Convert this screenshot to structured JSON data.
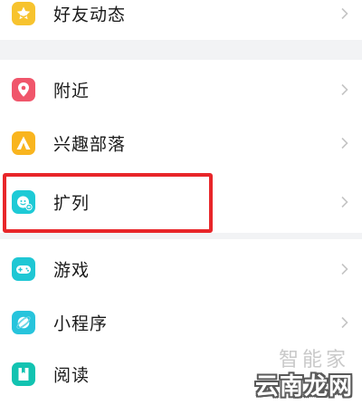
{
  "menu": {
    "items": [
      {
        "label": "好友动态",
        "icon": "star-icon",
        "color": "#f7c32e"
      },
      {
        "label": "附近",
        "icon": "location-pin-icon",
        "color": "#f0566b"
      },
      {
        "label": "兴趣部落",
        "icon": "tent-icon",
        "color": "#f9b51f"
      },
      {
        "label": "扩列",
        "icon": "smile-plus-icon",
        "color": "#1ecad6"
      },
      {
        "label": "游戏",
        "icon": "gamepad-icon",
        "color": "#1fc7d4"
      },
      {
        "label": "小程序",
        "icon": "planet-icon",
        "color": "#27c4dc"
      },
      {
        "label": "阅读",
        "icon": "book-icon",
        "color": "#12c3b1"
      }
    ]
  },
  "watermark": {
    "top": "智能家",
    "main": "云南龙网"
  },
  "colors": {
    "highlight_border": "#e8262a",
    "separator": "#f2f3f5",
    "chevron": "#c4c4c4"
  }
}
